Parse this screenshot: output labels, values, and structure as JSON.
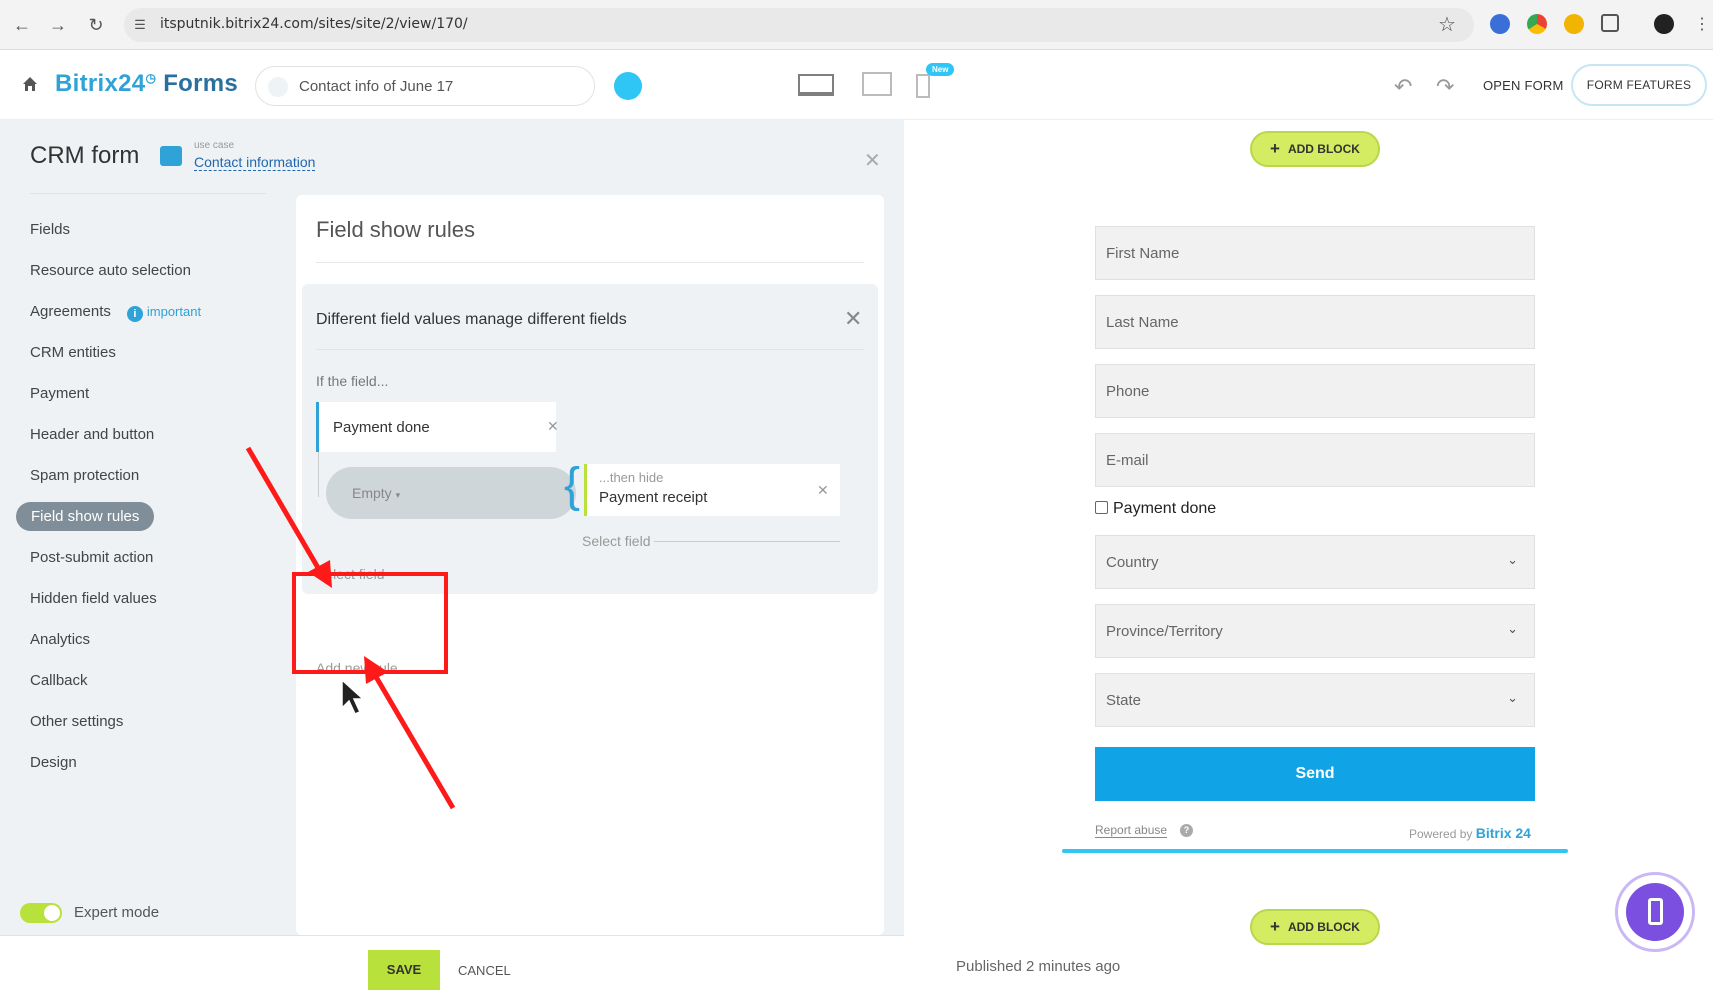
{
  "browser": {
    "url": "itsputnik.bitrix24.com/sites/site/2/view/170/"
  },
  "header": {
    "brand_name": "Bitrix24",
    "brand_product": "Forms",
    "form_name": "Contact info of June 17",
    "new_badge": "New",
    "open_form_label": "OPEN FORM",
    "form_features_label": "FORM FEATURES"
  },
  "panel": {
    "title": "CRM form",
    "use_case_label": "use case",
    "use_case_value": "Contact information",
    "menu": [
      {
        "label": "Fields"
      },
      {
        "label": "Resource auto selection"
      },
      {
        "label": "Agreements"
      },
      {
        "label": "CRM entities"
      },
      {
        "label": "Payment"
      },
      {
        "label": "Header and button"
      },
      {
        "label": "Spam protection"
      },
      {
        "label": "Field show rules"
      },
      {
        "label": "Post-submit action"
      },
      {
        "label": "Hidden field values"
      },
      {
        "label": "Analytics"
      },
      {
        "label": "Callback"
      },
      {
        "label": "Other settings"
      },
      {
        "label": "Design"
      }
    ],
    "important_label": "important",
    "info_glyph": "i",
    "expert_mode_label": "Expert mode"
  },
  "rules": {
    "title": "Field show rules",
    "rule_title": "Different field values manage different fields",
    "if_label": "If the field...",
    "field_name": "Payment done",
    "condition_value": "Empty",
    "action_label": "...then hide",
    "action_field": "Payment receipt",
    "select_field_label": "Select field",
    "add_rule_label": "Add new rule"
  },
  "actions": {
    "save_label": "SAVE",
    "cancel_label": "CANCEL"
  },
  "preview": {
    "add_block_label": "ADD BLOCK",
    "fields": [
      {
        "label": "First Name"
      },
      {
        "label": "Last Name"
      },
      {
        "label": "Phone"
      },
      {
        "label": "E-mail"
      },
      {
        "label": "Country"
      },
      {
        "label": "Province/Territory"
      },
      {
        "label": "State"
      }
    ],
    "checkbox_label": "Payment done",
    "send_label": "Send",
    "report_abuse": "Report abuse",
    "powered_by": "Powered by",
    "powered_brand": "Bitrix 24",
    "published_text": "Published 2 minutes ago"
  },
  "colors": {
    "accent_blue": "#2fa2d7",
    "send_blue": "#10a3e6",
    "lime": "#b9e13b",
    "annotation_red": "#ff1a1a"
  }
}
